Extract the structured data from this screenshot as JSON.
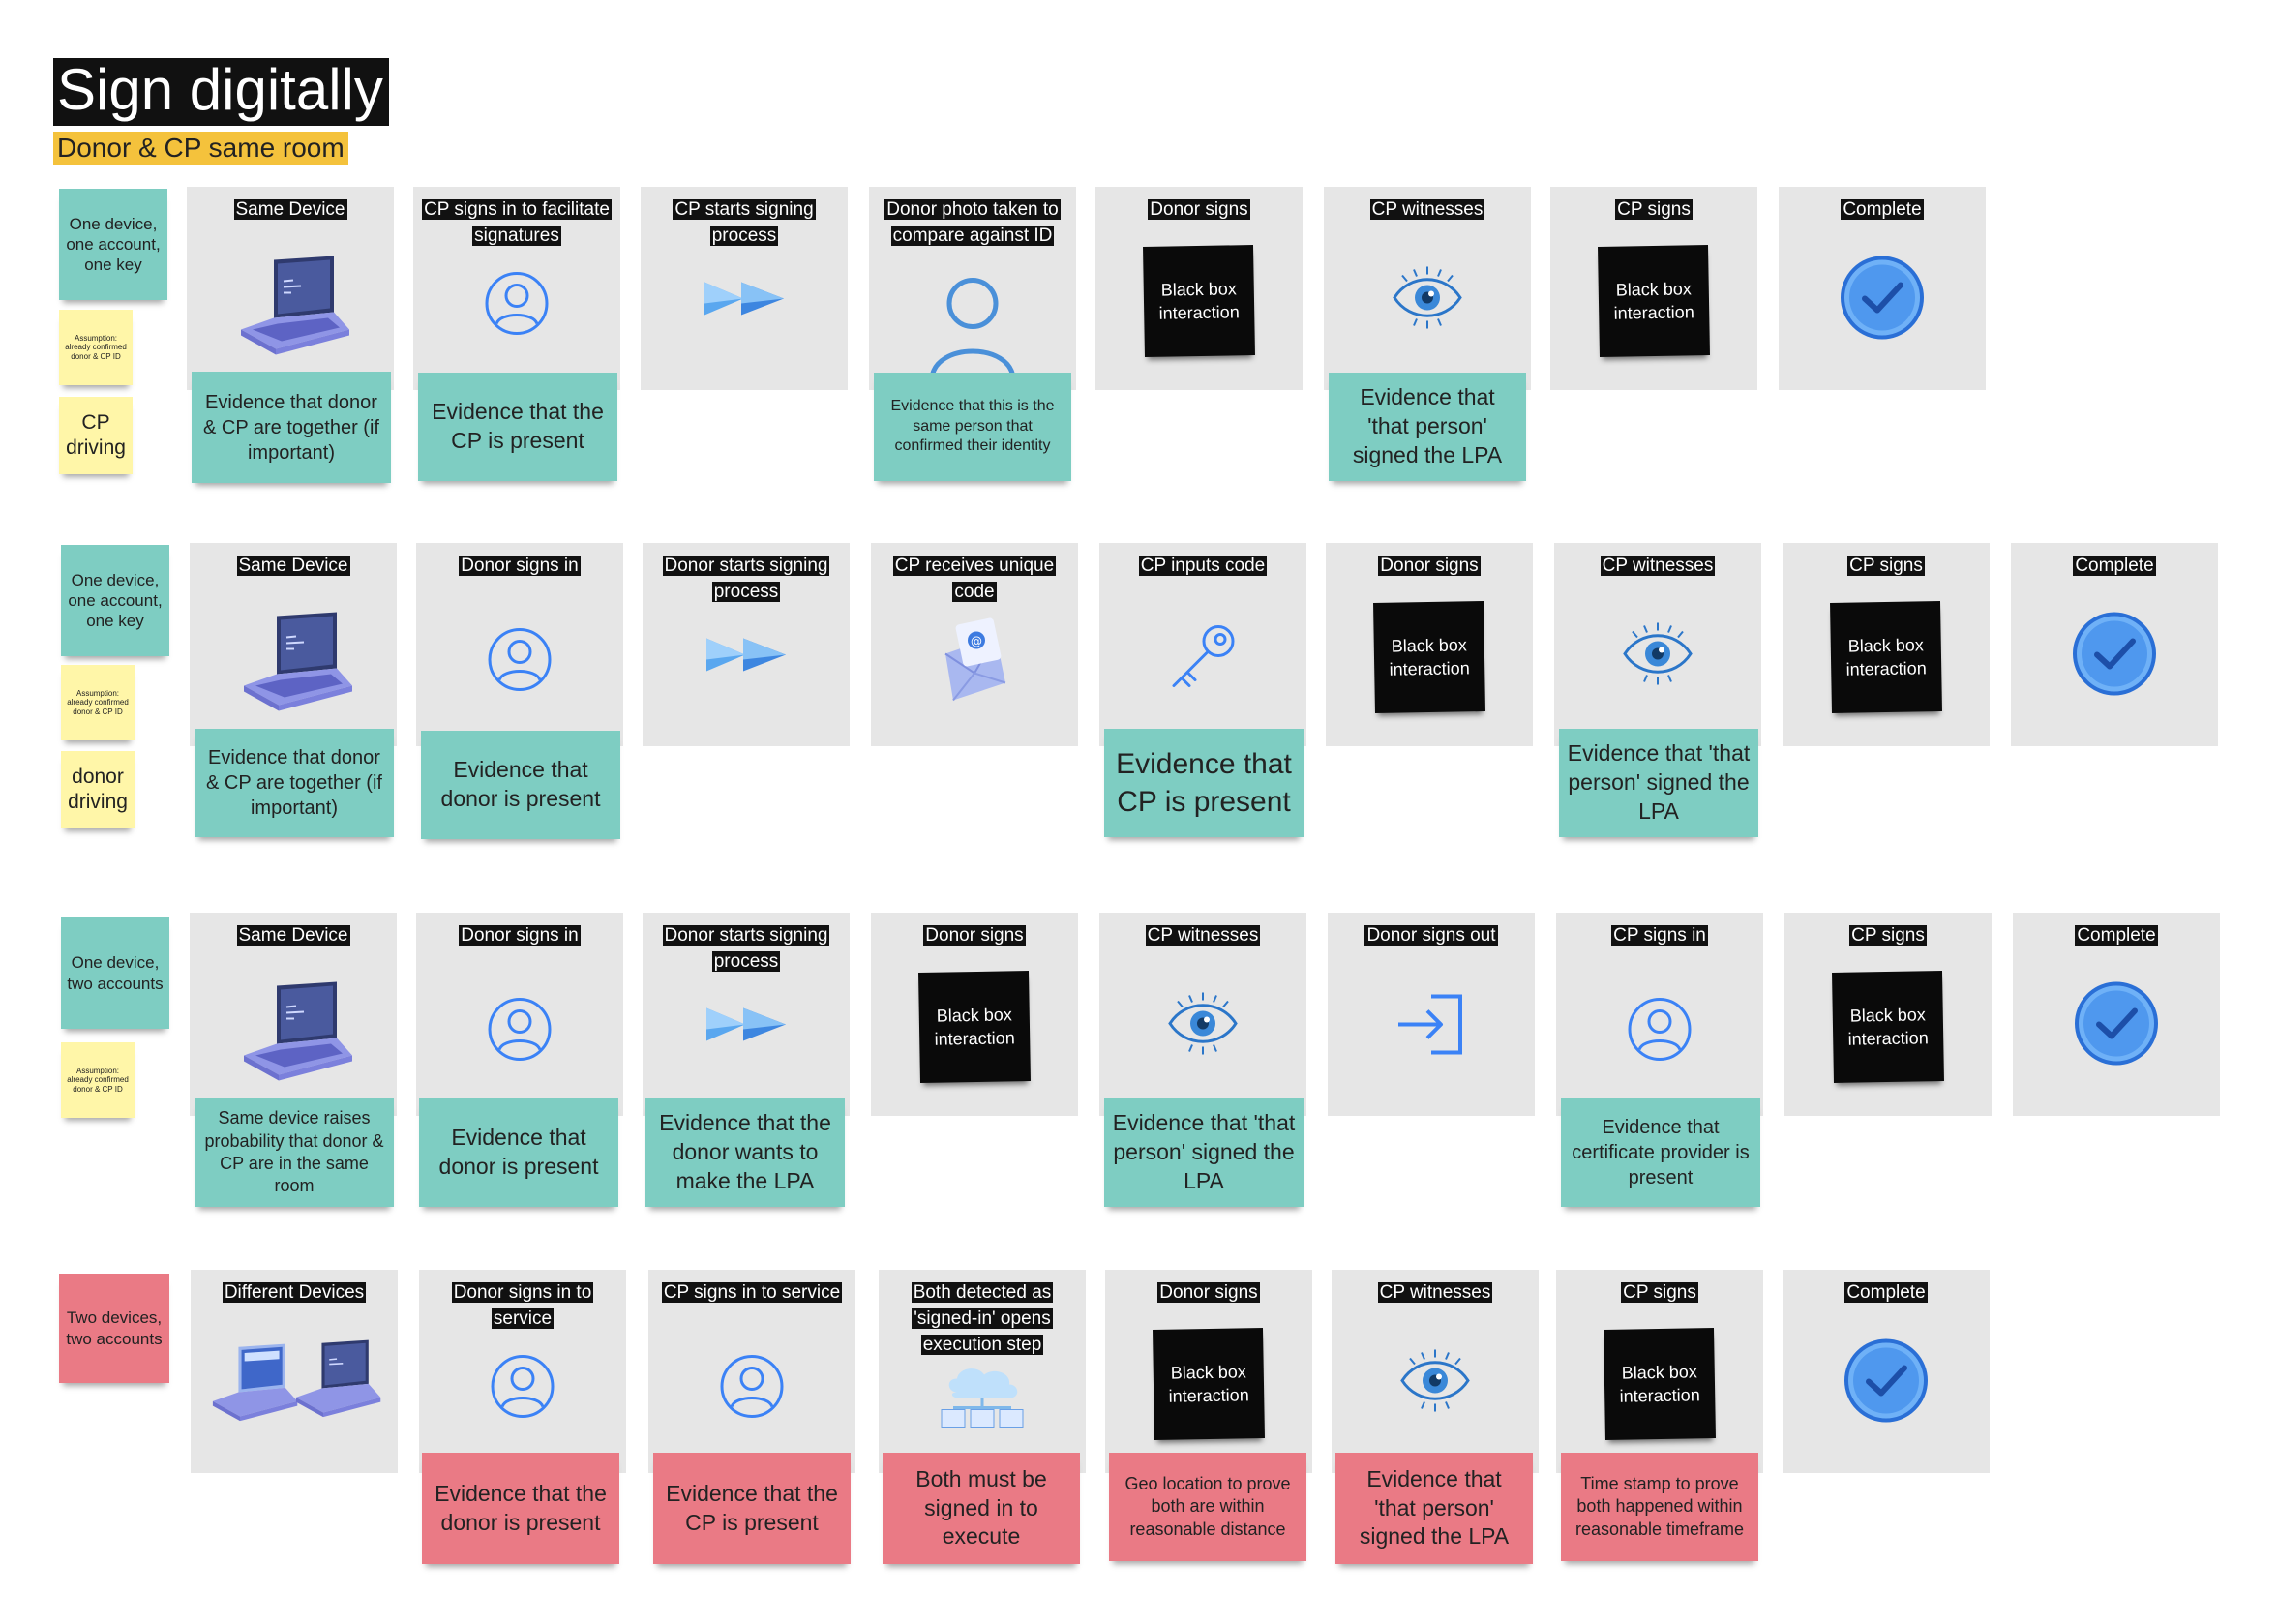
{
  "title": "Sign digitally",
  "subtitle": "Donor & CP same room",
  "rows": [
    {
      "label": "One device, one account, one key",
      "assumption": "Assumption: already confirmed donor & CP ID",
      "driver": "CP driving",
      "steps": [
        {
          "title": "Same Device",
          "icon": "laptop-icon",
          "evidence": "Evidence that donor & CP are together (if important)"
        },
        {
          "title": "CP signs in to facilitate signatures",
          "icon": "user-icon",
          "evidence": "Evidence that the CP is present"
        },
        {
          "title": "CP starts signing process",
          "icon": "fast-forward-icon"
        },
        {
          "title": "Donor photo taken to compare against ID",
          "icon": "person-icon",
          "evidence": "Evidence that this is the same person that confirmed their identity"
        },
        {
          "title": "Donor signs",
          "box": "Black box interaction"
        },
        {
          "title": "CP witnesses",
          "icon": "eye-icon",
          "evidence": "Evidence that 'that person' signed the LPA"
        },
        {
          "title": "CP signs",
          "box": "Black box interaction"
        },
        {
          "title": "Complete",
          "icon": "check-icon"
        }
      ]
    },
    {
      "label": "One device, one account, one key",
      "assumption": "Assumption: already confirmed donor & CP ID",
      "driver": "donor driving",
      "steps": [
        {
          "title": "Same Device",
          "icon": "laptop-icon",
          "evidence": "Evidence that donor & CP are together (if important)"
        },
        {
          "title": "Donor signs in",
          "icon": "user-icon",
          "evidence": "Evidence that donor is present"
        },
        {
          "title": "Donor starts signing process",
          "icon": "fast-forward-icon"
        },
        {
          "title": "CP receives unique code",
          "icon": "email-icon"
        },
        {
          "title": "CP inputs code",
          "icon": "key-icon",
          "evidence": "Evidence that CP is present"
        },
        {
          "title": "Donor signs",
          "box": "Black box interaction"
        },
        {
          "title": "CP witnesses",
          "icon": "eye-icon",
          "evidence": "Evidence that 'that person' signed the LPA"
        },
        {
          "title": "CP signs",
          "box": "Black box interaction"
        },
        {
          "title": "Complete",
          "icon": "check-icon"
        }
      ]
    },
    {
      "label": "One device, two accounts",
      "assumption": "Assumption: already confirmed donor & CP ID",
      "steps": [
        {
          "title": "Same Device",
          "icon": "laptop-icon",
          "evidence": "Same device raises probability that donor & CP are in the same room"
        },
        {
          "title": "Donor signs in",
          "icon": "user-icon",
          "evidence": "Evidence that donor is present"
        },
        {
          "title": "Donor starts signing process",
          "icon": "fast-forward-icon",
          "evidence": "Evidence that the donor wants to make the LPA"
        },
        {
          "title": "Donor signs",
          "box": "Black box interaction"
        },
        {
          "title": "CP witnesses",
          "icon": "eye-icon",
          "evidence": "Evidence that 'that person' signed the LPA"
        },
        {
          "title": "Donor signs out",
          "icon": "sign-out-icon"
        },
        {
          "title": "CP signs in",
          "icon": "user-icon",
          "evidence": "Evidence that certificate provider is present"
        },
        {
          "title": "CP signs",
          "box": "Black box interaction"
        },
        {
          "title": "Complete",
          "icon": "check-icon"
        }
      ]
    },
    {
      "label": "Two devices, two accounts",
      "steps": [
        {
          "title": "Different Devices",
          "icon": "two-laptops-icon"
        },
        {
          "title": "Donor signs in to service",
          "icon": "user-icon",
          "evidence": "Evidence that the donor is present"
        },
        {
          "title": "CP signs in to service",
          "icon": "user-icon",
          "evidence": "Evidence that the CP is present"
        },
        {
          "title": "Both detected as 'signed-in' opens execution step",
          "icon": "cloud-network-icon",
          "evidence": "Both must be signed in to execute"
        },
        {
          "title": "Donor signs",
          "box": "Black box interaction",
          "evidence": "Geo location  to prove both are within reasonable distance"
        },
        {
          "title": "CP witnesses",
          "icon": "eye-icon",
          "evidence": "Evidence that 'that person' signed the LPA"
        },
        {
          "title": "CP signs",
          "box": "Black box interaction",
          "evidence": "Time stamp to prove both happened within reasonable timeframe"
        },
        {
          "title": "Complete",
          "icon": "check-icon"
        }
      ]
    }
  ],
  "colors": {
    "teal": "#7ecdc2",
    "yellow": "#fff6a8",
    "red": "#ea7a85",
    "card": "#e6e6e6",
    "accent": "#3b82f6"
  }
}
